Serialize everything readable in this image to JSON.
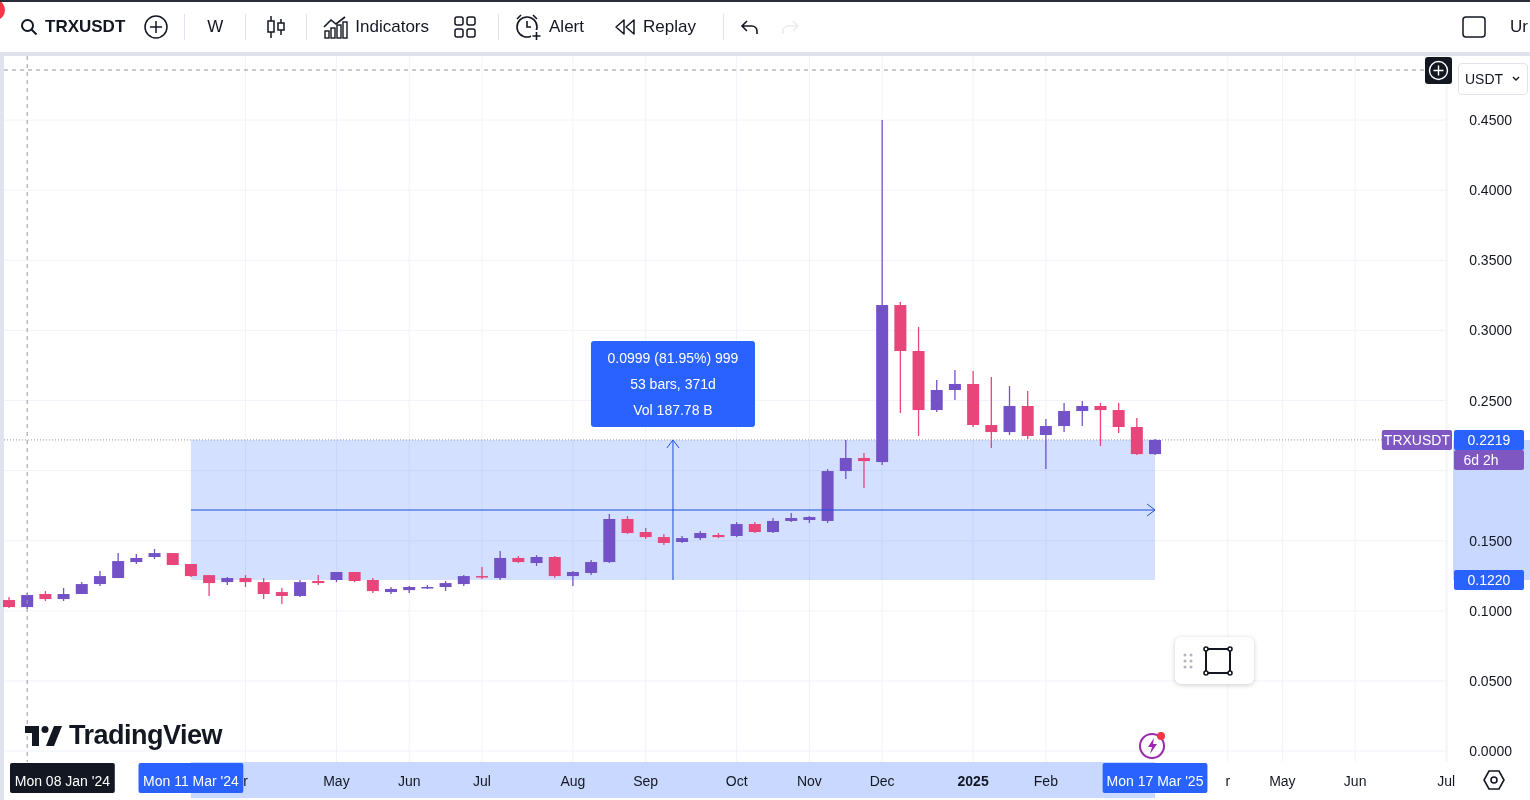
{
  "toolbar": {
    "symbol": "TRXUSDT",
    "interval": "W",
    "buttons": [
      {
        "kind": "indicators",
        "label": "Indicators"
      },
      {
        "kind": "alert",
        "label": "Alert"
      },
      {
        "kind": "replay",
        "label": "Replay"
      }
    ],
    "history": [
      {
        "kind": "undo",
        "disabled": false
      },
      {
        "kind": "redo",
        "disabled": true
      }
    ],
    "right_label": "Ur"
  },
  "chart": {
    "currency": "USDT",
    "logo": "TradingView",
    "measure": {
      "lines": [
        "0.0999 (81.95%) 999",
        "53 bars, 371d",
        "Vol 187.78 B"
      ],
      "start_date": "Mon 11 Mar '24",
      "end_date": "Mon 17 Mar '25",
      "low_label": "0.1220",
      "high_label": "0.2219"
    },
    "last_price": {
      "symbol": "TRXUSDT",
      "countdown": "6d 2h"
    },
    "crosshair": {
      "date": "Mon 08 Jan '24"
    },
    "chart_data": {
      "type": "candlestick",
      "grid": true,
      "categories": [
        null,
        null,
        null,
        null,
        null,
        null,
        null,
        null,
        null,
        null,
        null,
        null,
        null,
        "r",
        null,
        null,
        null,
        null,
        "May",
        null,
        null,
        null,
        "Jun",
        null,
        null,
        null,
        "Jul",
        null,
        null,
        null,
        null,
        "Aug",
        null,
        null,
        null,
        "Sep",
        null,
        null,
        null,
        null,
        "Oct",
        null,
        null,
        null,
        "Nov",
        null,
        null,
        null,
        "Dec",
        null,
        null,
        null,
        null,
        "2025",
        null,
        null,
        null,
        "Feb",
        null,
        null,
        null,
        null,
        null,
        null,
        null,
        null,
        null,
        "r",
        null,
        null,
        "May",
        null,
        null,
        null,
        "Jun",
        null,
        null,
        null,
        null,
        "Jul"
      ],
      "ohlc": [
        [
          0.1077,
          0.1098,
          0.102,
          0.1027
        ],
        [
          0.1027,
          0.1127,
          0.1013,
          0.1113
        ],
        [
          0.112,
          0.1141,
          0.107,
          0.1084
        ],
        [
          0.1084,
          0.1163,
          0.107,
          0.112
        ],
        [
          0.112,
          0.1205,
          0.112,
          0.1191
        ],
        [
          0.1191,
          0.1284,
          0.1177,
          0.1248
        ],
        [
          0.1234,
          0.1412,
          0.1234,
          0.1355
        ],
        [
          0.1348,
          0.1405,
          0.1334,
          0.1377
        ],
        [
          0.1384,
          0.1441,
          0.1369,
          0.1412
        ],
        [
          0.1412,
          0.1412,
          0.1327,
          0.1327
        ],
        [
          0.1334,
          0.1334,
          0.1241,
          0.1248
        ],
        [
          0.1255,
          0.1255,
          0.1106,
          0.1198
        ],
        [
          0.1205,
          0.1241,
          0.1184,
          0.1234
        ],
        [
          0.1234,
          0.1255,
          0.117,
          0.1205
        ],
        [
          0.1205,
          0.1234,
          0.1084,
          0.112
        ],
        [
          0.1134,
          0.1163,
          0.1049,
          0.1106
        ],
        [
          0.1106,
          0.122,
          0.1098,
          0.1205
        ],
        [
          0.1213,
          0.1255,
          0.1184,
          0.1198
        ],
        [
          0.122,
          0.1277,
          0.1205,
          0.1277
        ],
        [
          0.1277,
          0.1277,
          0.1205,
          0.1213
        ],
        [
          0.122,
          0.1234,
          0.1127,
          0.1141
        ],
        [
          0.1134,
          0.117,
          0.112,
          0.1156
        ],
        [
          0.1148,
          0.1177,
          0.1127,
          0.117
        ],
        [
          0.1163,
          0.1184,
          0.1156,
          0.117
        ],
        [
          0.117,
          0.1213,
          0.1141,
          0.1198
        ],
        [
          0.1191,
          0.1255,
          0.1177,
          0.1248
        ],
        [
          0.1248,
          0.1312,
          0.1227,
          0.1241
        ],
        [
          0.1234,
          0.1427,
          0.122,
          0.1377
        ],
        [
          0.1377,
          0.1391,
          0.1341,
          0.1348
        ],
        [
          0.1341,
          0.1398,
          0.132,
          0.1384
        ],
        [
          0.1384,
          0.1391,
          0.1234,
          0.1248
        ],
        [
          0.1248,
          0.1284,
          0.1177,
          0.1277
        ],
        [
          0.127,
          0.1362,
          0.1255,
          0.1348
        ],
        [
          0.1348,
          0.169,
          0.1341,
          0.1655
        ],
        [
          0.1655,
          0.1676,
          0.1548,
          0.1555
        ],
        [
          0.1562,
          0.1591,
          0.1512,
          0.1526
        ],
        [
          0.1526,
          0.1548,
          0.1469,
          0.1484
        ],
        [
          0.1491,
          0.1534,
          0.1484,
          0.1519
        ],
        [
          0.1519,
          0.1569,
          0.1505,
          0.1555
        ],
        [
          0.1541,
          0.1555,
          0.1519,
          0.1526
        ],
        [
          0.1534,
          0.1633,
          0.1526,
          0.1619
        ],
        [
          0.1619,
          0.1633,
          0.1555,
          0.1562
        ],
        [
          0.1562,
          0.1662,
          0.1555,
          0.1641
        ],
        [
          0.1641,
          0.1698,
          0.1633,
          0.1662
        ],
        [
          0.1648,
          0.1676,
          0.1626,
          0.1669
        ],
        [
          0.1641,
          0.2011,
          0.1626,
          0.1997
        ],
        [
          0.1997,
          0.2218,
          0.194,
          0.209
        ],
        [
          0.209,
          0.2126,
          0.1876,
          0.2068
        ],
        [
          0.2061,
          0.45,
          0.204,
          0.3181
        ],
        [
          0.3181,
          0.3203,
          0.2411,
          0.2853
        ],
        [
          0.2853,
          0.3024,
          0.2247,
          0.2432
        ],
        [
          0.2432,
          0.2646,
          0.2418,
          0.2575
        ],
        [
          0.2575,
          0.2718,
          0.2504,
          0.2618
        ],
        [
          0.2618,
          0.2711,
          0.2311,
          0.2325
        ],
        [
          0.2325,
          0.2668,
          0.2161,
          0.2275
        ],
        [
          0.2275,
          0.2603,
          0.2254,
          0.2461
        ],
        [
          0.2461,
          0.2568,
          0.2225,
          0.2247
        ],
        [
          0.2254,
          0.2368,
          0.2011,
          0.2318
        ],
        [
          0.2318,
          0.2482,
          0.2275,
          0.2425
        ],
        [
          0.2425,
          0.2496,
          0.2318,
          0.2461
        ],
        [
          0.2461,
          0.2482,
          0.2175,
          0.2432
        ],
        [
          0.2432,
          0.2482,
          0.2268,
          0.2311
        ],
        [
          0.2311,
          0.2375,
          0.2111,
          0.2118
        ],
        [
          0.2118,
          0.2225,
          0.2111,
          0.2219
        ],
        null,
        null,
        null,
        null,
        null,
        null,
        null,
        null,
        null,
        null,
        null,
        null,
        null,
        null,
        null,
        null
      ],
      "ylim": [
        -0.0078,
        0.4957
      ],
      "yticks": [
        {
          "value": 0,
          "label": "0.0000"
        },
        {
          "value": 0.05,
          "label": "0.0500"
        },
        {
          "value": 0.1,
          "label": "0.1000"
        },
        {
          "value": 0.15,
          "label": "0.1500"
        },
        {
          "value": 0.25,
          "label": "0.2500"
        },
        {
          "value": 0.3,
          "label": "0.3000"
        },
        {
          "value": 0.35,
          "label": "0.3500"
        },
        {
          "value": 0.4,
          "label": "0.4000"
        },
        {
          "value": 0.45,
          "label": "0.4500"
        }
      ],
      "bands": [
        {
          "axis": "y",
          "from": 0.122,
          "to": 0.2219
        }
      ],
      "ref_lines": [
        {
          "axis": "y",
          "value": 0.2219
        },
        {
          "axis": "y",
          "value": 0.4857
        },
        {
          "axis": "y",
          "value": 0.1719
        }
      ]
    }
  }
}
